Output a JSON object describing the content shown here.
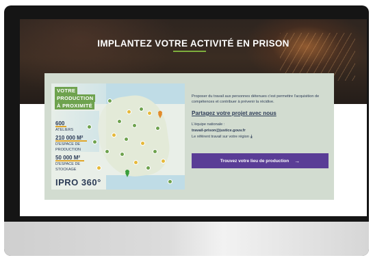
{
  "hero": {
    "title": "IMPLANTEZ VOTRE ACTIVITÉ EN PRISON"
  },
  "card": {
    "stats": {
      "header_lines": [
        "VOTRE",
        "PRODUCTION",
        "À PROXIMITÉ"
      ],
      "ateliers_value": "600",
      "ateliers_label": "ATELIERS",
      "production_value": "210 000 M²",
      "production_label_1": "D'ESPACE DE",
      "production_label_2": "PRODUCTION",
      "stockage_value": "50 000 M²",
      "stockage_label_1": "D'ESPACE DE",
      "stockage_label_2": "STOCKAGE",
      "brand": "IPRO 360°"
    },
    "intro": "Proposer du travail aux personnes détenues c'est permettre l'acquisition de compétences et contribuer à prévenir la récidive.",
    "share_link": "Partagez votre projet avec nous",
    "team_label": "L'équipe nationale :",
    "team_email": "travail-prison@justice.gouv.fr",
    "regional_ref": "Le référent travail sur votre région",
    "cta_label": "Trouvez votre lieu de production",
    "cta_arrow": "→"
  },
  "colors": {
    "accent": "#5a3d96",
    "card_bg": "#d2dcd0",
    "green": "#6ea24e",
    "underline": "#7fae3d"
  },
  "icons": {
    "download": "download-icon",
    "arrow": "arrow-right-icon"
  }
}
